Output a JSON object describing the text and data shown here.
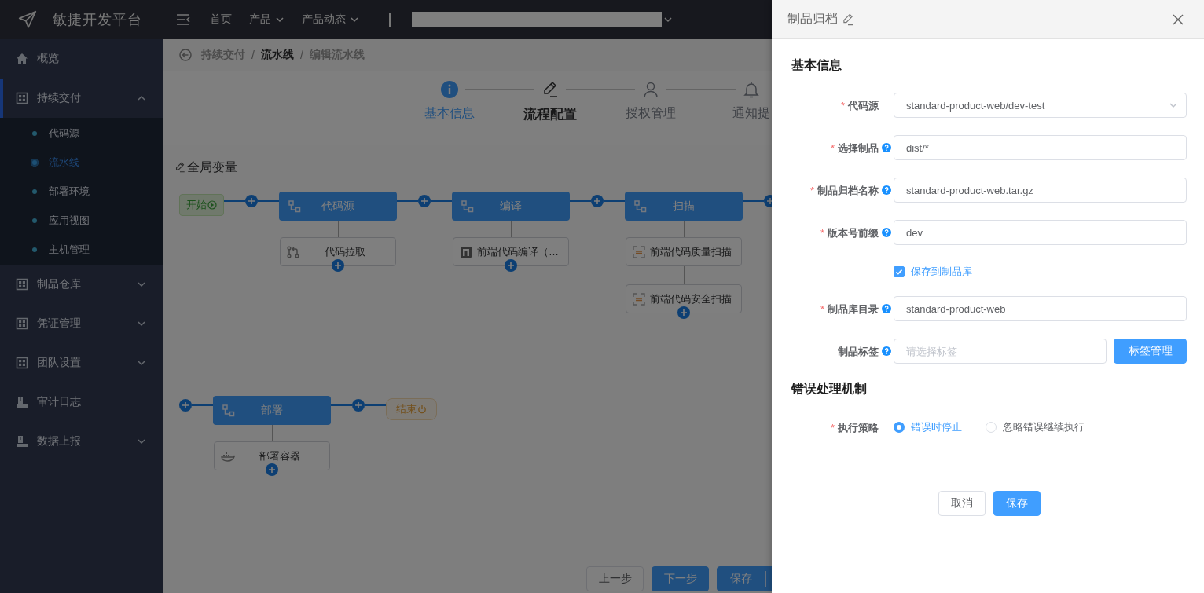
{
  "header": {
    "title": "敏捷开发平台",
    "nav": [
      {
        "label": "首页",
        "dropdown": false
      },
      {
        "label": "产品",
        "dropdown": true
      },
      {
        "label": "产品动态",
        "dropdown": true
      }
    ]
  },
  "sidebar": {
    "items": [
      {
        "label": "概览",
        "selected": false
      },
      {
        "label": "持续交付",
        "selected": true,
        "expanded": true,
        "children": [
          {
            "label": "代码源",
            "selected": false
          },
          {
            "label": "流水线",
            "selected": true
          },
          {
            "label": "部署环境",
            "selected": false
          },
          {
            "label": "应用视图",
            "selected": false
          },
          {
            "label": "主机管理",
            "selected": false
          }
        ]
      },
      {
        "label": "制品仓库",
        "selected": false,
        "expanded": false
      },
      {
        "label": "凭证管理",
        "selected": false,
        "expanded": false
      },
      {
        "label": "团队设置",
        "selected": false,
        "expanded": false
      },
      {
        "label": "审计日志",
        "selected": false
      },
      {
        "label": "数据上报",
        "selected": false,
        "expanded": false
      }
    ]
  },
  "breadcrumb": [
    {
      "label": "持续交付",
      "selected": false
    },
    {
      "separator": "/",
      "label": "流水线",
      "selected": true
    },
    {
      "separator": "/",
      "label": "编辑流水线",
      "selected": false
    }
  ],
  "steps": [
    {
      "label": "基本信息",
      "done": true,
      "selected": false
    },
    {
      "label": "流程配置",
      "done": false,
      "selected": true
    },
    {
      "label": "授权管理",
      "done": false,
      "selected": false
    },
    {
      "label": "通知提",
      "done": false,
      "selected": false
    }
  ],
  "pipeline": {
    "title": "全局变量",
    "start": "开始",
    "end": "结束",
    "rows": [
      {
        "stages": [
          {
            "name": "代码源",
            "tasks": [
              {
                "kind": "checkout",
                "name": "代码拉取"
              }
            ]
          },
          {
            "name": "编译",
            "tasks": [
              {
                "kind": "build",
                "name": "前端代码编译（…"
              }
            ]
          },
          {
            "name": "扫描",
            "tasks": [
              {
                "kind": "scan",
                "name": "前端代码质量扫描"
              },
              {
                "kind": "scan",
                "name": "前端代码安全扫描"
              }
            ]
          }
        ]
      },
      {
        "stages": [
          {
            "name": "部署",
            "tasks": [
              {
                "kind": "deploy",
                "name": "部署容器"
              }
            ]
          }
        ]
      }
    ]
  },
  "footer_buttons": [
    {
      "kind": "default",
      "label": "上一步"
    },
    {
      "kind": "primary",
      "label": "下一步"
    },
    {
      "kind": "split",
      "label": "保存"
    }
  ],
  "drawer": {
    "title": "制品归档",
    "sections": [
      {
        "title": "基本信息",
        "fields": [
          {
            "kind": "select",
            "mark": "*",
            "label": "代码源",
            "value": "standard-product-web/dev-test"
          },
          {
            "kind": "input",
            "mark": "*",
            "label": "选择制品",
            "help": true,
            "value": "dist/*"
          },
          {
            "kind": "input",
            "mark": "*",
            "label": "制品归档名称",
            "help": true,
            "value": "standard-product-web.tar.gz"
          },
          {
            "kind": "input",
            "mark": "*",
            "label": "版本号前缀",
            "help": true,
            "value": "dev"
          },
          {
            "kind": "checkbox",
            "label": "保存到制品库",
            "checked": true
          },
          {
            "kind": "input",
            "mark": "*",
            "label": "制品库目录",
            "help": true,
            "value": "standard-product-web"
          },
          {
            "kind": "input_button",
            "label": "制品标签",
            "help": true,
            "placeholder": "请选择标签",
            "button": "标签管理"
          }
        ]
      },
      {
        "title": "错误处理机制",
        "fields": [
          {
            "kind": "radio",
            "mark": "*",
            "label": "执行策略",
            "options": [
              {
                "label": "错误时停止",
                "selected": true
              },
              {
                "label": "忽略错误继续执行",
                "selected": false
              }
            ]
          }
        ]
      }
    ],
    "buttons": [
      {
        "kind": "default",
        "label": "取消"
      },
      {
        "kind": "primary",
        "label": "保存"
      }
    ]
  }
}
